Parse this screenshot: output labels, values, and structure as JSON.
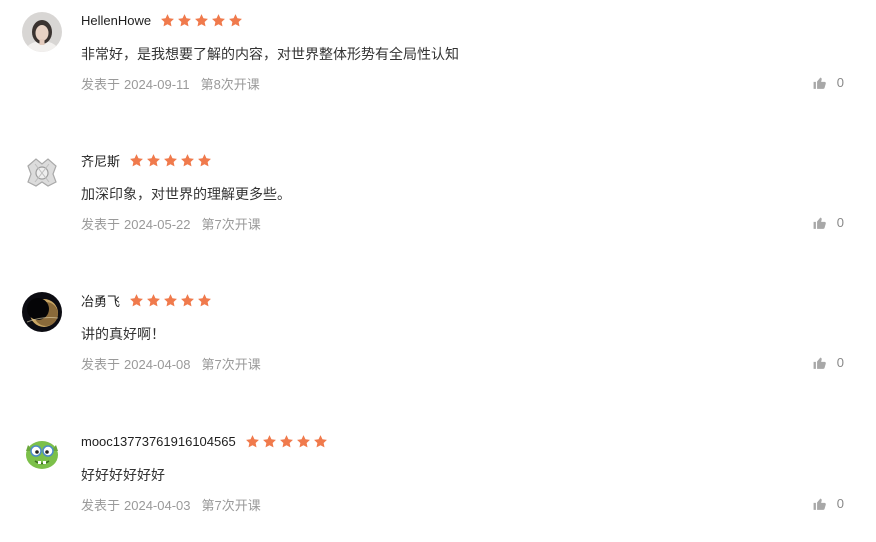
{
  "colors": {
    "star": "#f07a4c",
    "like_icon": "#a8a8a8",
    "meta_text": "#9a9a9a"
  },
  "reviews": [
    {
      "username": "HellenHowe",
      "rating": 5,
      "content": "非常好，是我想要了解的内容，对世界整体形势有全局性认知",
      "posted_label": "发表于",
      "date": "2024-09-11",
      "chapter": "第8次开课",
      "likes": "0",
      "avatar": "woman-portrait"
    },
    {
      "username": "齐尼斯",
      "rating": 5,
      "content": "加深印象，对世界的理解更多些。",
      "posted_label": "发表于",
      "date": "2024-05-22",
      "chapter": "第7次开课",
      "likes": "0",
      "avatar": "silver-emblem"
    },
    {
      "username": "冶勇飞",
      "rating": 5,
      "content": "讲的真好啊！",
      "posted_label": "发表于",
      "date": "2024-04-08",
      "chapter": "第7次开课",
      "likes": "0",
      "avatar": "planet-eclipse"
    },
    {
      "username": "mooc13773761916104565",
      "rating": 5,
      "content": "好好好好好好",
      "posted_label": "发表于",
      "date": "2024-04-03",
      "chapter": "第7次开课",
      "likes": "0",
      "avatar": "green-cartoon-monster"
    }
  ]
}
